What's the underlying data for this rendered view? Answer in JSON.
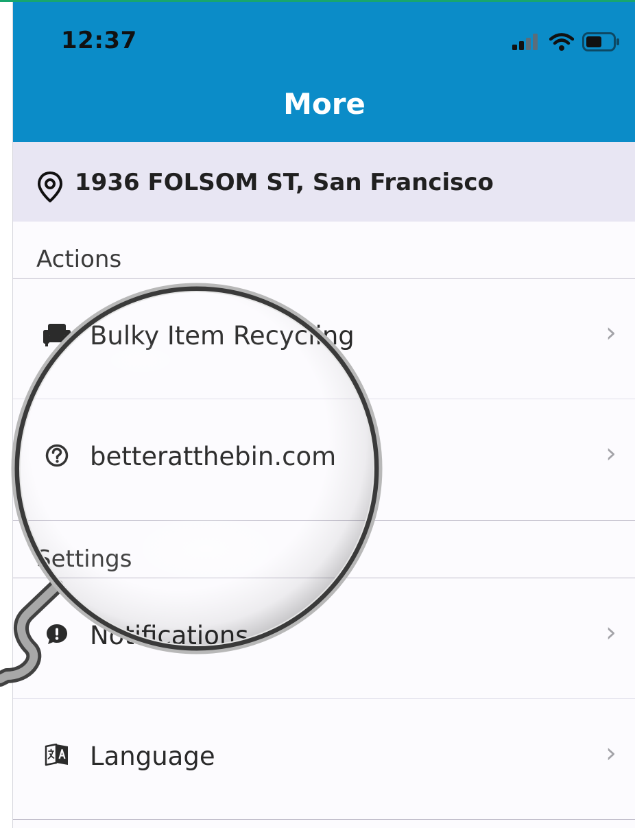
{
  "status_bar": {
    "time": "12:37"
  },
  "header": {
    "title": "More"
  },
  "location": {
    "address": "1936 FOLSOM ST, San Francisco"
  },
  "sections": {
    "actions": {
      "label": "Actions",
      "items": [
        {
          "label": "Bulky Item Recycling",
          "icon": "couch-icon"
        },
        {
          "label": "betteratthebin.com",
          "icon": "help-circle-icon"
        }
      ]
    },
    "settings": {
      "label": "Settings",
      "items": [
        {
          "label": "Notifications",
          "icon": "alert-bubble-icon"
        },
        {
          "label": "Language",
          "icon": "translate-icon"
        }
      ]
    }
  },
  "colors": {
    "header_bg": "#0b8cc8",
    "address_bg": "#e8e6f3",
    "accent_strip": "#18a66f",
    "chevron": "#a3a3a8"
  }
}
